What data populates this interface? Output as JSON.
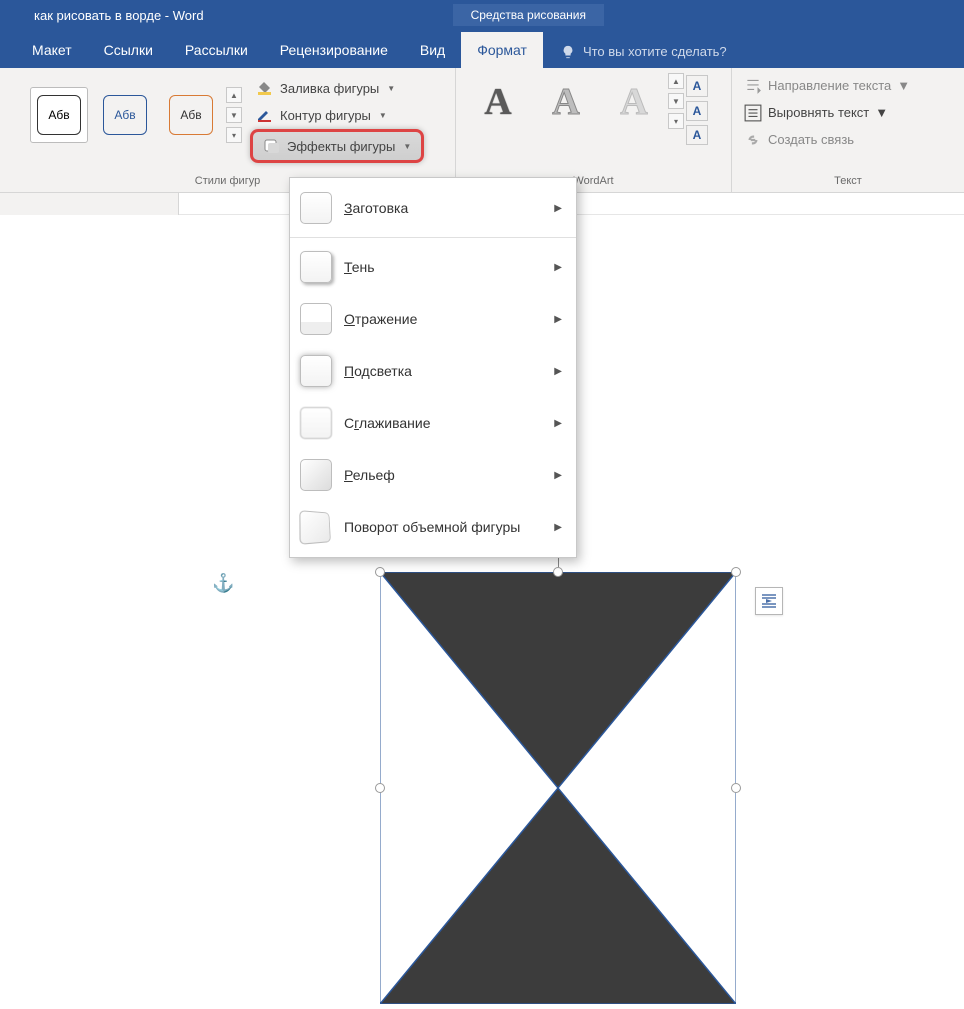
{
  "titlebar": {
    "doc_title": "как рисовать в ворде - Word",
    "tool_context": "Средства рисования"
  },
  "tabs": {
    "items": [
      "Макет",
      "Ссылки",
      "Рассылки",
      "Рецензирование",
      "Вид",
      "Формат"
    ],
    "active_index": 5,
    "tell_me": "Что вы хотите сделать?"
  },
  "ribbon": {
    "styles_group_label": "Стили фигур",
    "wordart_group_label": "WordArt",
    "text_group_label": "Текст",
    "style_thumb_text": "Абв",
    "shape_fill": "Заливка фигуры",
    "shape_outline": "Контур фигуры",
    "shape_effects": "Эффекты фигуры",
    "wa_glyph": "А",
    "text_direction": "Направление текста",
    "align_text": "Выровнять текст",
    "create_link": "Создать связь",
    "a_small": "A"
  },
  "fx_menu": {
    "preset": "Заготовка",
    "shadow": "Тень",
    "reflection": "Отражение",
    "glow": "Подсветка",
    "soft_edges": "Сглаживание",
    "bevel": "Рельеф",
    "rotation3d": "Поворот объемной фигуры"
  }
}
